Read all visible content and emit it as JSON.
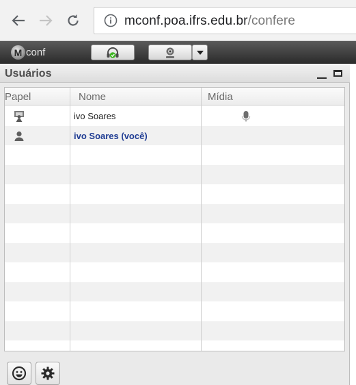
{
  "browser": {
    "url_domain": "mconf.poa.ifrs.edu.br",
    "url_path": "/confere",
    "icons": [
      "back-arrow-icon",
      "forward-arrow-icon",
      "reload-icon",
      "info-icon"
    ]
  },
  "toolbar": {
    "logo_text": "conf",
    "logo_letter": "M",
    "buttons": [
      "headset-icon",
      "webcam-icon",
      "dropdown-arrow-icon"
    ],
    "headset_accent": "#3cb521"
  },
  "users_panel": {
    "title": "Usuários",
    "columns": {
      "role": "Papel",
      "name": "Nome",
      "media": "Mídia"
    },
    "users": [
      {
        "role_icon": "presenter-icon",
        "name": "ivo Soares",
        "media_icon": "microphone-icon",
        "is_me": false
      },
      {
        "role_icon": "viewer-icon",
        "name": "ivo Soares (você)",
        "media_icon": "",
        "is_me": true
      }
    ],
    "footer_buttons": [
      "emoji-status-icon",
      "settings-gear-icon"
    ]
  },
  "colors": {
    "self_user_name": "#1f3c93",
    "toolbar_bg": "#3a3a3a",
    "panel_bg": "#eaeaea"
  }
}
